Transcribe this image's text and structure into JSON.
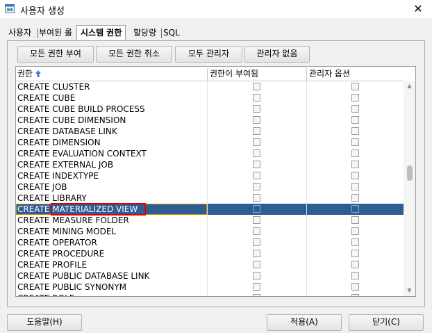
{
  "window": {
    "title": "사용자 생성",
    "close_label": "✕"
  },
  "tabs": [
    {
      "label": "사용자",
      "active": false
    },
    {
      "label": "부여된 롤",
      "active": false
    },
    {
      "label": "시스템 권한",
      "active": true
    },
    {
      "label": "할당량",
      "active": false
    },
    {
      "label": "SQL",
      "active": false
    }
  ],
  "toolbar": {
    "grant_all": "모든 권한 부여",
    "revoke_all": "모든 권한 취소",
    "all_admin": "모두 관리자",
    "no_admin": "관리자 없음"
  },
  "grid": {
    "columns": [
      "권한",
      "권한이 부여됨",
      "관리자 옵션"
    ],
    "selected_index": 11,
    "rows": [
      "CREATE CLUSTER",
      "CREATE CUBE",
      "CREATE CUBE BUILD PROCESS",
      "CREATE CUBE DIMENSION",
      "CREATE DATABASE LINK",
      "CREATE DIMENSION",
      "CREATE EVALUATION CONTEXT",
      "CREATE EXTERNAL JOB",
      "CREATE INDEXTYPE",
      "CREATE JOB",
      "CREATE LIBRARY",
      "CREATE MATERIALIZED VIEW",
      "CREATE MEASURE FOLDER",
      "CREATE MINING MODEL",
      "CREATE OPERATOR",
      "CREATE PROCEDURE",
      "CREATE PROFILE",
      "CREATE PUBLIC DATABASE LINK",
      "CREATE PUBLIC SYNONYM",
      "CREATE ROLE"
    ]
  },
  "footer": {
    "help": "도움말(H)",
    "apply": "적용(A)",
    "close": "닫기(C)"
  },
  "colors": {
    "selection": "#2d5d93",
    "highlight": "#e00000",
    "sort_arrow": "#3a7bd5"
  }
}
